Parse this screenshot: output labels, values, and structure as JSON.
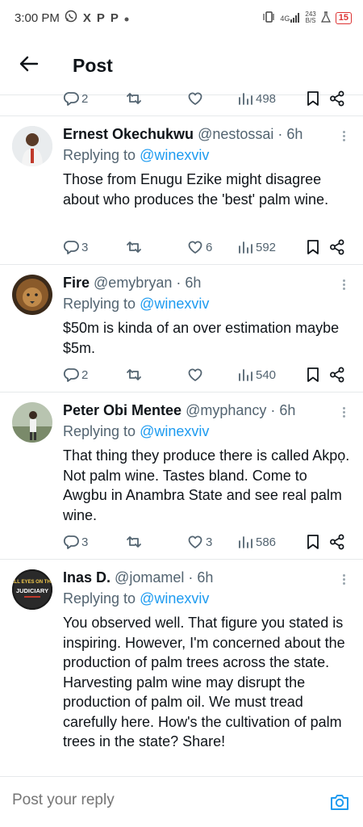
{
  "status_bar": {
    "time": "3:00 PM",
    "app_glyphs": [
      "X",
      "P",
      "P"
    ],
    "net_type": "4G",
    "net_speed_value": "243",
    "net_speed_unit": "B/S",
    "battery": "15"
  },
  "header": {
    "title": "Post"
  },
  "top_actions": {
    "replies": "2",
    "retweets": "",
    "likes": "",
    "views": "498"
  },
  "tweets": [
    {
      "name": "Ernest Okechukwu",
      "handle": "@nestossai",
      "time": "· 6h",
      "replying_prefix": "Replying to ",
      "replying_to": "@winexviv",
      "text": "Those from Enugu Ezike might disagree about who produces the 'best' palm wine.",
      "replies": "3",
      "likes": "6",
      "views": "592"
    },
    {
      "name": "Fire",
      "handle": "@emybryan",
      "time": "· 6h",
      "replying_prefix": "Replying to ",
      "replying_to": "@winexviv",
      "text": "$50m is kinda of an over estimation maybe $5m.",
      "replies": "2",
      "likes": "",
      "views": "540"
    },
    {
      "name": "Peter Obi Mentee",
      "handle": "@myphancy",
      "time": "· 6h",
      "replying_prefix": "Replying to ",
      "replying_to": "@winexviv",
      "text": "That thing they produce there is called Akpọ. Not palm wine. Tastes bland. Come to Awgbu in Anambra State and see real palm wine.",
      "replies": "3",
      "likes": "3",
      "views": "586"
    },
    {
      "name": "Inas D.",
      "handle": "@jomamel",
      "time": "· 6h",
      "replying_prefix": "Replying to ",
      "replying_to": "@winexviv",
      "text": "You observed well. That figure you stated is inspiring. However, I'm concerned about the production of palm trees across the state. Harvesting palm wine may disrupt the production of palm oil. We must tread carefully here.  How's the cultivation of palm trees in the state? Share!",
      "replies": "",
      "likes": "",
      "views": "",
      "avatar_text": "ALL EYES ON THE JUDICIARY"
    }
  ],
  "composer": {
    "placeholder": "Post your reply"
  },
  "colors": {
    "link": "#1d9bf0",
    "muted": "#536471",
    "text": "#0f1419",
    "battery": "#d33333"
  }
}
